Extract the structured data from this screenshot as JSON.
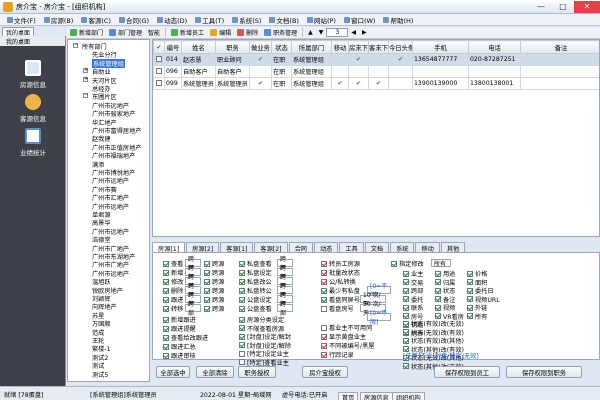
{
  "window": {
    "title": "房介宝 - 房介宝 - [组织机构]"
  },
  "menu": [
    "文件(F)",
    "房源(B)",
    "客源(C)",
    "合同(G)",
    "动态(D)",
    "工具(T)",
    "系统(S)",
    "文档(B)",
    "网站(P)",
    "窗口(W)",
    "帮助(H)"
  ],
  "left": {
    "tabs": [
      "我的桌面",
      "我的桌面"
    ],
    "header": "我的桌面",
    "items": [
      "房源信息",
      "客源信息",
      "业绩统计"
    ]
  },
  "toolbar": {
    "buttons": [
      "新增部门",
      "部门管理",
      "智能",
      "新增员工",
      "编辑",
      "删除",
      "职务管理"
    ],
    "number": "3"
  },
  "tree": {
    "nodes": [
      "所有部门",
      "先业分行",
      "系统管理组",
      "自助业",
      "天河片区",
      "总经办",
      "东圃片区",
      "广州市远地产",
      "广州市骏家地产",
      "华汇地产",
      "广州市富得居地产",
      "赵我建",
      "广州市正值房地产",
      "广州市福瑞地产",
      "满添",
      "广州市博悦地产",
      "广州市远地产",
      "广州市赛",
      "广州市汇地产",
      "广州市远地产",
      "单君源",
      "高景华",
      "广州市远地产",
      "浩德堂",
      "广州市广地产",
      "广州市东湖地产",
      "广州市广地产",
      "广州市远地产",
      "温旭跃",
      "锐欧房地产",
      "刘颖辉",
      "向辉地产",
      "苏星",
      "万国顺",
      "范成",
      "王轮",
      "繁楼-1",
      "测试2",
      "测试",
      "测试5"
    ]
  },
  "grid": {
    "columns": [
      "编号",
      "姓名",
      "职务",
      "做业务",
      "状态",
      "所属部门",
      "移动",
      "房末下",
      "客末下",
      "今日头条",
      "手机",
      "电话",
      "备注"
    ],
    "rows": [
      [
        "014",
        "赵志慧",
        "职业顾问",
        "✔",
        "在职",
        "系统管理组",
        "",
        "✔",
        "",
        "✔",
        "13654877777",
        "020-87287251",
        ""
      ],
      [
        "096",
        "自助客户",
        "自助客户",
        "",
        "在职",
        "系统管理组",
        "",
        "",
        "",
        "",
        "",
        "",
        ""
      ],
      [
        "099",
        "系统管理员",
        "系统管理员",
        "✔",
        "在职",
        "系统管理组",
        "✔",
        "✔",
        "✔",
        "",
        "13900139000",
        "13800138001",
        ""
      ]
    ]
  },
  "perm_tabs": [
    "房源[1]",
    "房源[2]",
    "客源[1]",
    "客源[2]",
    "合同",
    "动态",
    "工具",
    "文档",
    "系统",
    "移动",
    "其他"
  ],
  "perm": {
    "c1": [
      "查看",
      "新增",
      "修改",
      "删除",
      "跟进",
      "转移"
    ],
    "c1b": [
      "跨部",
      "跨部",
      "跨部",
      "跨部",
      "跨部",
      "跨部"
    ],
    "c1c": [
      "跨源",
      "跨源",
      "跨源",
      "跨源",
      "跨源",
      "跨源"
    ],
    "c2": [
      "私盘查看",
      "私盘设定",
      "私盘改公",
      "私盘转公",
      "公盘设定",
      "公盘查看"
    ],
    "c2b": [
      "跨部",
      "跨部",
      "跨部",
      "跨部",
      "跨部",
      "跨部"
    ],
    "c3": [
      "转员工房源",
      "批量改状态",
      "公/私转换",
      "最少有私盘",
      "看盘同屏号",
      "看盘房号"
    ],
    "c3v": [
      "[0=不限]",
      "10 次/天",
      "50 次/天",
      "[0=不限]"
    ],
    "c4": [
      "指定修改",
      "业主",
      "交易",
      "跨部",
      "委托",
      "联系",
      "房号",
      "钥匙",
      "附件"
    ],
    "c4a": [
      "用途",
      "归属",
      "状态",
      "备注",
      "视频",
      "VR看房"
    ],
    "c4b": [
      "价格",
      "面积",
      "委托日",
      "视频URL",
      "外链",
      "所有"
    ],
    "c4c": [
      "状态(有效)改(无效)",
      "状态(无效)改(有效)",
      "状态(有效)改(其他)",
      "状态(其他)改(有效)",
      "状态(无效)改(其他)",
      "状态(其他)改(无效)"
    ],
    "bl": [
      "新增跟进",
      "跟进提醒",
      "查看给改跟进",
      "跟进汇总",
      "跟进审核"
    ],
    "bm": [
      "房源分类设定",
      "不限查看房源",
      "[封盘]设定/解封",
      "[封盘]设定/解除",
      "[特定]设定业主",
      "[特定]查看业主"
    ],
    "br": [
      "看业主不可用同",
      "显示黄盘业主",
      "不同被编号/黑屋",
      "行踪记录"
    ],
    "note": "[任意]不含[封盘/特定/无效]",
    "actions": [
      "全部选中",
      "全部清除",
      "职务授权",
      "房介宝授权",
      "保存权限到员工",
      "保存权限到职务"
    ]
  },
  "status": {
    "a": "就绪 [78蛋盘]",
    "b": "[系统管理组]系统管理员",
    "c": "2022-08-01 星期一",
    "d": "局域网",
    "e": "虚号电话:已开启",
    "tabs": [
      "首页",
      "房源信息",
      "组织机构"
    ]
  }
}
